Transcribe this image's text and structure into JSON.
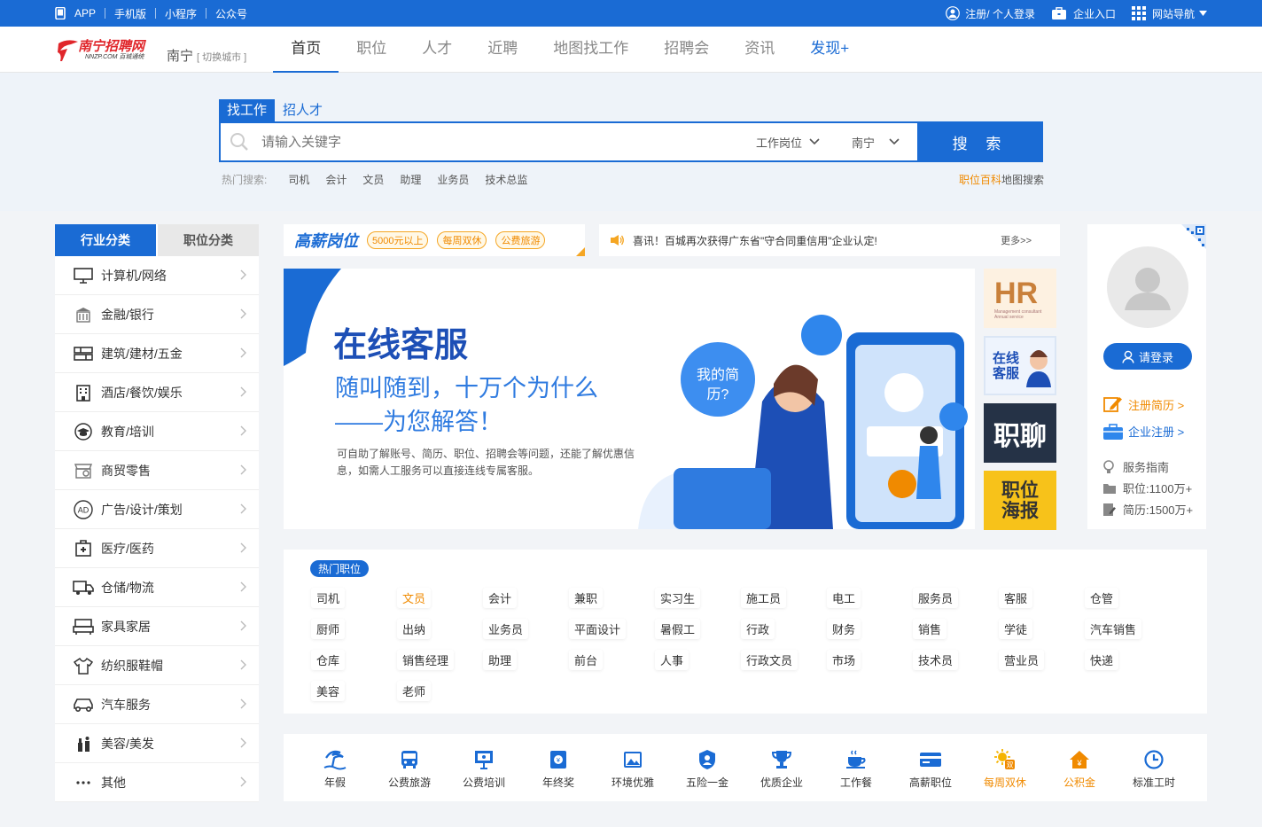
{
  "topbar": {
    "links": [
      "APP",
      "手机版",
      "小程序",
      "公众号"
    ],
    "login": "注册/ 个人登录",
    "company": "企业入口",
    "sitenav": "网站导航"
  },
  "brand": {
    "logo_text": "南宁招聘网",
    "logo_sub": "NNZP.COM 百城通统",
    "city": "南宁",
    "switch_city": "[ 切换城市 ]"
  },
  "nav": {
    "items": [
      "首页",
      "职位",
      "人才",
      "近聘",
      "地图找工作",
      "招聘会",
      "资讯",
      "发现+"
    ]
  },
  "search": {
    "tabs": [
      "找工作",
      "招人才"
    ],
    "placeholder": "请输入关键字",
    "job_dropdown": "工作岗位",
    "city_dropdown": "南宁",
    "button": "搜 索",
    "hot_label": "热门搜索:",
    "hot_words": [
      "司机",
      "会计",
      "文员",
      "助理",
      "业务员",
      "技术总监"
    ],
    "right_links": [
      "职位百科",
      "地图搜索"
    ]
  },
  "sidebar": {
    "tabs": [
      "行业分类",
      "职位分类"
    ],
    "items": [
      {
        "label": "计算机/网络",
        "icon": "computer-icon"
      },
      {
        "label": "金融/银行",
        "icon": "bank-icon"
      },
      {
        "label": "建筑/建材/五金",
        "icon": "building-icon"
      },
      {
        "label": "酒店/餐饮/娱乐",
        "icon": "hotel-icon"
      },
      {
        "label": "教育/培训",
        "icon": "graduation-cap-icon"
      },
      {
        "label": "商贸零售",
        "icon": "shop-icon"
      },
      {
        "label": "广告/设计/策划",
        "icon": "ad-icon"
      },
      {
        "label": "医疗/医药",
        "icon": "medical-icon"
      },
      {
        "label": "仓储/物流",
        "icon": "truck-icon"
      },
      {
        "label": "家具家居",
        "icon": "furniture-icon"
      },
      {
        "label": "纺织服鞋帽",
        "icon": "shirt-icon"
      },
      {
        "label": "汽车服务",
        "icon": "car-icon"
      },
      {
        "label": "美容/美发",
        "icon": "cosmetics-icon"
      },
      {
        "label": "其他",
        "icon": "more-icon"
      }
    ]
  },
  "promo": {
    "title": "高薪岗位",
    "tags": [
      "5000元以上",
      "每周双休",
      "公费旅游"
    ]
  },
  "notice": {
    "text": "喜讯！百城再次获得广东省\"守合同重信用\"企业认定!",
    "more": "更多>>"
  },
  "banner": {
    "title": "在线客服",
    "subtitle1": "随叫随到，十万个为什么",
    "subtitle2": "——为您解答！",
    "desc": "可自助了解账号、简历、职位、招聘会等问题，还能了解优惠信息，如需人工服务可以直接连线专属客服。",
    "bubble": "我的简历?"
  },
  "thumbs": {
    "hr": "HR",
    "hr_sub": "Management consultant Annual service",
    "service": "在线客服",
    "chat": "职聊",
    "poster": "职位海报"
  },
  "user": {
    "login": "请登录",
    "register_resume": "注册简历 >",
    "company_register": "企业注册 >",
    "guide": "服务指南",
    "jobs": "职位:1100万+",
    "resumes": "简历:1500万+"
  },
  "hotjobs": {
    "badge": "热门职位",
    "rows": [
      [
        "司机",
        "文员",
        "会计",
        "兼职",
        "实习生",
        "施工员",
        "电工",
        "服务员",
        "客服",
        "仓管"
      ],
      [
        "厨师",
        "出纳",
        "业务员",
        "平面设计",
        "暑假工",
        "行政",
        "财务",
        "销售",
        "学徒",
        "汽车销售"
      ],
      [
        "仓库",
        "销售经理",
        "助理",
        "前台",
        "人事",
        "行政文员",
        "市场",
        "技术员",
        "营业员",
        "快递"
      ],
      [
        "美容",
        "老师"
      ]
    ]
  },
  "benefits": {
    "items": [
      {
        "label": "年假",
        "icon": "beach-icon"
      },
      {
        "label": "公费旅游",
        "icon": "bus-icon"
      },
      {
        "label": "公费培训",
        "icon": "training-icon"
      },
      {
        "label": "年终奖",
        "icon": "bonus-icon"
      },
      {
        "label": "环境优雅",
        "icon": "picture-icon"
      },
      {
        "label": "五险一金",
        "icon": "shield-icon"
      },
      {
        "label": "优质企业",
        "icon": "trophy-icon"
      },
      {
        "label": "工作餐",
        "icon": "coffee-icon"
      },
      {
        "label": "高薪职位",
        "icon": "card-icon"
      },
      {
        "label": "每周双休",
        "icon": "sun-icon"
      },
      {
        "label": "公积金",
        "icon": "house-icon"
      },
      {
        "label": "标准工时",
        "icon": "clock-icon"
      }
    ]
  },
  "colors": {
    "primary": "#1a6bd4",
    "accent": "#f08a00",
    "logo": "#e0262b"
  }
}
